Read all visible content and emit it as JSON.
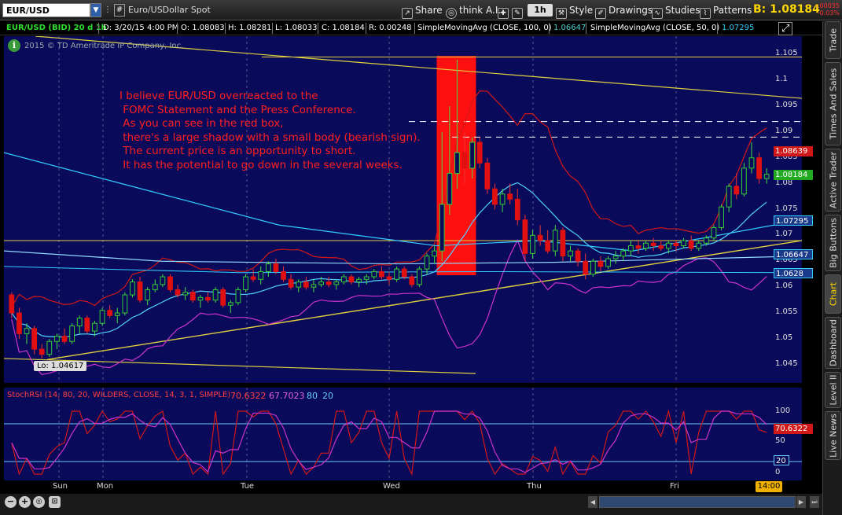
{
  "toolbar": {
    "symbol": "EUR/USD",
    "hash": "#",
    "description": "Euro/USDollar Spot",
    "share": "Share",
    "think": "think A.I.",
    "timeframe": "1h",
    "style": "Style",
    "drawings": "Drawings",
    "studies": "Studies",
    "patterns": "Patterns",
    "bid": "B: 1.08184",
    "change_top": "-.00035",
    "change_bottom": "-0.03%"
  },
  "chart_header": {
    "title": "EUR/USD (BID) 20 d 1h",
    "date": "D: 3/20/15 4:00 PM",
    "open": "O: 1.08083",
    "high": "H: 1.08281",
    "low": "L: 1.08033",
    "close": "C: 1.08184",
    "range": "R: 0.00248",
    "sma100": "SimpleMovingAvg (CLOSE, 100, 0)",
    "sma100_val": "1.06647",
    "sma50": "SimpleMovingAvg (CLOSE, 50, 0)",
    "sma50_val": "1.07295"
  },
  "copyright": "2015 © TD Ameritrade IP Company, Inc.",
  "annotation": "I believe EUR/USD overreacted to the\n FOMC Statement and the Press Conference.\n As you can see in the red box,\n there's a large shadow with a small body (bearish sign).\n The current price is an opportunity to short.\n It has the potential to go down in the several weeks.",
  "low_tag": "Lo: 1.04617",
  "price_scale": [
    "1.105",
    "1.1",
    "1.095",
    "1.09",
    "1.085",
    "1.08",
    "1.075",
    "1.07",
    "1.065",
    "1.06",
    "1.055",
    "1.05",
    "1.045"
  ],
  "price_tags": {
    "upper_band": "1.08639",
    "last": "1.08184",
    "sma50": "1.07295",
    "sma100": "1.06647",
    "lower_band": "1.0628"
  },
  "study": {
    "name": "StochRSI (14, 80, 20, WILDERS, CLOSE, 14, 3, 1, SIMPLE)",
    "k": "70.6322",
    "d": "67.7023",
    "over": "80",
    "under": "20",
    "scale": [
      "100",
      "50",
      "0"
    ],
    "tag_k": "70.6322",
    "tag_under": "20"
  },
  "dates": [
    "Sun",
    "Mon",
    "Tue",
    "Wed",
    "Thu",
    "Fri"
  ],
  "time_tag": "14:00",
  "side_tabs": [
    "Trade",
    "Times And Sales",
    "Active Trader",
    "Big Buttons",
    "Chart",
    "Dashboard",
    "Level II",
    "Live News"
  ],
  "colors": {
    "bg": "#0a0a5a",
    "up": "#33cc33",
    "down": "#e01010",
    "sma50": "#33ccff",
    "sma100": "#4fd0d0",
    "bb": "#d01818",
    "stoch_k": "#d01818",
    "stoch_d": "#cc33cc",
    "trend": "#e0d040"
  },
  "chart_data": {
    "type": "candlestick",
    "ylim": [
      1.043,
      1.107
    ],
    "candles": [
      [
        1.0585,
        1.059,
        1.054,
        1.055
      ],
      [
        1.055,
        1.056,
        1.05,
        1.051
      ],
      [
        1.051,
        1.053,
        1.049,
        1.052
      ],
      [
        1.052,
        1.0525,
        1.047,
        1.048
      ],
      [
        1.048,
        1.049,
        1.0462,
        1.047
      ],
      [
        1.047,
        1.05,
        1.0465,
        1.0495
      ],
      [
        1.0495,
        1.051,
        1.048,
        1.0505
      ],
      [
        1.0505,
        1.052,
        1.049,
        1.0495
      ],
      [
        1.0495,
        1.053,
        1.049,
        1.0525
      ],
      [
        1.0525,
        1.0545,
        1.051,
        1.054
      ],
      [
        1.054,
        1.0545,
        1.051,
        1.0515
      ],
      [
        1.0515,
        1.0535,
        1.0505,
        1.053
      ],
      [
        1.053,
        1.056,
        1.0525,
        1.0555
      ],
      [
        1.0555,
        1.0565,
        1.054,
        1.0545
      ],
      [
        1.0545,
        1.056,
        1.053,
        1.055
      ],
      [
        1.055,
        1.059,
        1.0545,
        1.0585
      ],
      [
        1.0585,
        1.0615,
        1.058,
        1.061
      ],
      [
        1.061,
        1.062,
        1.057,
        1.0575
      ],
      [
        1.0575,
        1.06,
        1.0565,
        1.0595
      ],
      [
        1.0595,
        1.0615,
        1.059,
        1.0605
      ],
      [
        1.0605,
        1.0625,
        1.06,
        1.062
      ],
      [
        1.062,
        1.0625,
        1.059,
        1.0595
      ],
      [
        1.0595,
        1.0605,
        1.058,
        1.0585
      ],
      [
        1.0585,
        1.06,
        1.0575,
        1.059
      ],
      [
        1.059,
        1.0595,
        1.057,
        1.0575
      ],
      [
        1.0575,
        1.0585,
        1.056,
        1.058
      ],
      [
        1.058,
        1.059,
        1.057,
        1.0575
      ],
      [
        1.0575,
        1.06,
        1.057,
        1.0595
      ],
      [
        1.0595,
        1.06,
        1.056,
        1.0565
      ],
      [
        1.0565,
        1.0575,
        1.055,
        1.057
      ],
      [
        1.057,
        1.06,
        1.0565,
        1.0595
      ],
      [
        1.0595,
        1.0625,
        1.059,
        1.062
      ],
      [
        1.062,
        1.0635,
        1.061,
        1.0615
      ],
      [
        1.0615,
        1.064,
        1.0605,
        1.063
      ],
      [
        1.063,
        1.065,
        1.062,
        1.0645
      ],
      [
        1.0645,
        1.0655,
        1.0625,
        1.063
      ],
      [
        1.063,
        1.064,
        1.061,
        1.0615
      ],
      [
        1.0615,
        1.0625,
        1.0595,
        1.06
      ],
      [
        1.06,
        1.0615,
        1.059,
        1.061
      ],
      [
        1.061,
        1.062,
        1.0595,
        1.06
      ],
      [
        1.06,
        1.0615,
        1.059,
        1.0605
      ],
      [
        1.0605,
        1.062,
        1.06,
        1.061
      ],
      [
        1.061,
        1.062,
        1.06,
        1.0605
      ],
      [
        1.0605,
        1.0615,
        1.0595,
        1.061
      ],
      [
        1.061,
        1.0625,
        1.0605,
        1.062
      ],
      [
        1.062,
        1.0625,
        1.0605,
        1.061
      ],
      [
        1.061,
        1.062,
        1.06,
        1.0615
      ],
      [
        1.0615,
        1.0625,
        1.0605,
        1.062
      ],
      [
        1.062,
        1.0635,
        1.0615,
        1.063
      ],
      [
        1.063,
        1.064,
        1.0615,
        1.062
      ],
      [
        1.062,
        1.063,
        1.0605,
        1.0615
      ],
      [
        1.0615,
        1.064,
        1.061,
        1.0635
      ],
      [
        1.0635,
        1.064,
        1.0615,
        1.062
      ],
      [
        1.062,
        1.0625,
        1.06,
        1.0605
      ],
      [
        1.0605,
        1.064,
        1.06,
        1.0635
      ],
      [
        1.0635,
        1.0665,
        1.0625,
        1.066
      ],
      [
        1.066,
        1.068,
        1.0645,
        1.067
      ],
      [
        1.067,
        1.09,
        1.065,
        1.076
      ],
      [
        1.076,
        1.095,
        1.074,
        1.082
      ],
      [
        1.082,
        1.104,
        1.079,
        1.086
      ],
      [
        1.086,
        1.09,
        1.08,
        1.083
      ],
      [
        1.083,
        1.089,
        1.081,
        1.088
      ],
      [
        1.088,
        1.089,
        1.083,
        1.084
      ],
      [
        1.084,
        1.085,
        1.078,
        1.079
      ],
      [
        1.079,
        1.08,
        1.075,
        1.076
      ],
      [
        1.076,
        1.079,
        1.0745,
        1.078
      ],
      [
        1.078,
        1.08,
        1.076,
        1.077
      ],
      [
        1.077,
        1.079,
        1.072,
        1.073
      ],
      [
        1.073,
        1.074,
        1.065,
        1.0665
      ],
      [
        1.0665,
        1.071,
        1.0655,
        1.07
      ],
      [
        1.07,
        1.072,
        1.068,
        1.069
      ],
      [
        1.069,
        1.071,
        1.0665,
        1.067
      ],
      [
        1.067,
        1.072,
        1.066,
        1.071
      ],
      [
        1.071,
        1.0715,
        1.065,
        1.066
      ],
      [
        1.066,
        1.068,
        1.065,
        1.067
      ],
      [
        1.067,
        1.0675,
        1.064,
        1.065
      ],
      [
        1.065,
        1.0665,
        1.0615,
        1.0625
      ],
      [
        1.0625,
        1.0655,
        1.062,
        1.065
      ],
      [
        1.065,
        1.066,
        1.063,
        1.064
      ],
      [
        1.064,
        1.066,
        1.0635,
        1.0655
      ],
      [
        1.0655,
        1.067,
        1.0645,
        1.066
      ],
      [
        1.066,
        1.0675,
        1.065,
        1.067
      ],
      [
        1.067,
        1.069,
        1.066,
        1.068
      ],
      [
        1.068,
        1.069,
        1.0665,
        1.0675
      ],
      [
        1.0675,
        1.069,
        1.067,
        1.0685
      ],
      [
        1.0685,
        1.0695,
        1.067,
        1.068
      ],
      [
        1.068,
        1.069,
        1.067,
        1.0675
      ],
      [
        1.0675,
        1.069,
        1.0665,
        1.0685
      ],
      [
        1.0685,
        1.069,
        1.067,
        1.068
      ],
      [
        1.068,
        1.0695,
        1.0675,
        1.069
      ],
      [
        1.069,
        1.07,
        1.067,
        1.0675
      ],
      [
        1.0675,
        1.069,
        1.067,
        1.0685
      ],
      [
        1.0685,
        1.07,
        1.068,
        1.0695
      ],
      [
        1.0695,
        1.072,
        1.069,
        1.0715
      ],
      [
        1.0715,
        1.076,
        1.071,
        1.0755
      ],
      [
        1.0755,
        1.08,
        1.0745,
        1.0795
      ],
      [
        1.0795,
        1.082,
        1.077,
        1.078
      ],
      [
        1.078,
        1.084,
        1.0775,
        1.083
      ],
      [
        1.083,
        1.088,
        1.082,
        1.085
      ],
      [
        1.085,
        1.086,
        1.08,
        1.081
      ],
      [
        1.081,
        1.083,
        1.08,
        1.0818
      ]
    ]
  }
}
